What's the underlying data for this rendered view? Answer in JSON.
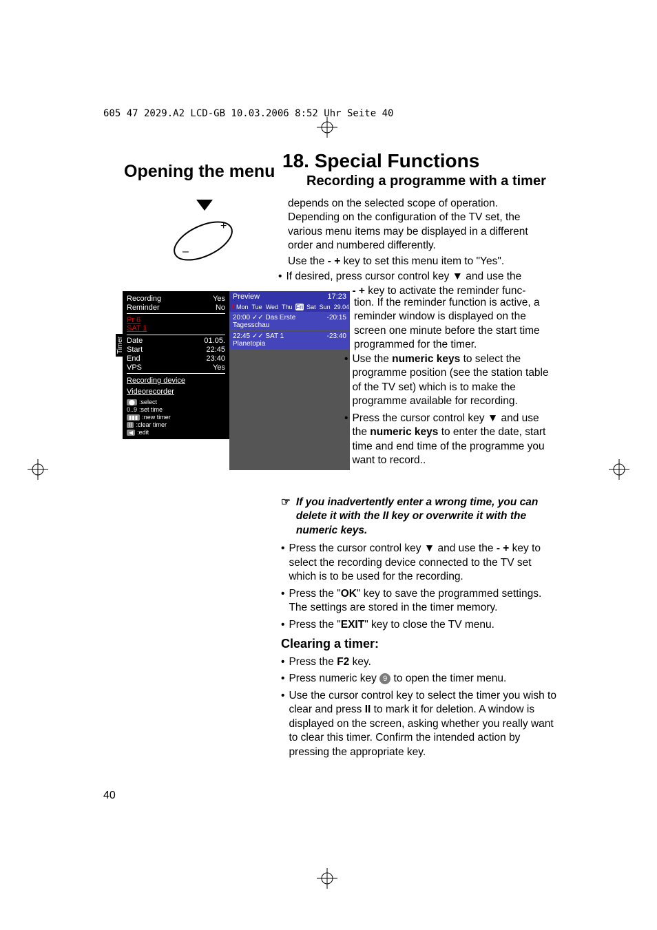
{
  "header_line": "605 47 2029.A2 LCD-GB  10.03.2006  8:52 Uhr  Seite 40",
  "opening_title": "Opening the menu",
  "section_number": "18.",
  "section_title": "Special Functions",
  "subtitle": "Recording a programme with a timer",
  "timer": {
    "vert_label": "Timer",
    "recording_label": "Recording",
    "recording_val": "Yes",
    "reminder_label": "Reminder",
    "reminder_val": "No",
    "pr": "Pr   6",
    "sat": "SAT 1",
    "date_label": "Date",
    "date_val": "01.05.",
    "start_label": "Start",
    "start_val": "22:45",
    "end_label": "End",
    "end_val": "23:40",
    "vps_label": "VPS",
    "vps_val": "Yes",
    "device_label": "Recording device",
    "device_val": "Videorecorder",
    "legend": [
      {
        "key": "⬤",
        "text": ":select"
      },
      {
        "key": "0..9",
        "text": ":set time"
      },
      {
        "key": "▮▮▮",
        "text": ":new timer"
      },
      {
        "key": "II",
        "text": ":clear timer"
      },
      {
        "key": "◀",
        "text": ":edit"
      }
    ]
  },
  "preview": {
    "title": "Preview",
    "time": "17:23",
    "days": [
      "Mon",
      "Tue",
      "Wed",
      "Thu",
      "Fri",
      "Sat",
      "Sun"
    ],
    "date": "29.04.",
    "items": [
      {
        "start": "20:00",
        "marks": "✓✓",
        "channel": "Das Erste",
        "name": "Tagesschau",
        "end": "-20:15"
      },
      {
        "start": "22:45",
        "marks": "✓✓",
        "channel": "SAT 1",
        "name": "Planetopia",
        "end": "-23:40"
      }
    ]
  },
  "body": {
    "p1": "depends on the selected scope of operation. Depending on the configuration of the TV set, the various menu items may be displayed in a different order and numbered differently.",
    "p2a": "Use the ",
    "p2b": " key to set this menu item to \"Yes\".",
    "b1a": "If desired, press cursor control key ▼ and use the",
    "b1b": " key to activate the reminder func-",
    "i1": "tion. If the reminder function is active, a reminder window is displayed on the screen one minute before the start time programmed for the timer.",
    "i2a": "Use the ",
    "i2b": "numeric keys",
    "i2c": " to select the programme position (see the station table of the TV set) which is to make the programme available for recording.",
    "i3a": "Press the cursor control key ▼ and use the ",
    "i3b": "numeric keys",
    "i3c": " to enter the date, start time and end time of the programme you want to record..",
    "note": "If you inadvertently enter a wrong time, you can delete it with the II key or overwrite it with the numeric keys.",
    "b4a": "Press the cursor control key ▼ and use the ",
    "b4b": " key to select the recording device connected to the TV set which is to be used for the recording.",
    "b5a": "Press the \"",
    "b5b": "OK",
    "b5c": "\" key to save the programmed settings. The settings are stored in the timer memory.",
    "b6a": "Press the \"",
    "b6b": "EXIT",
    "b6c": "\" key to close the TV menu.",
    "clearing": "Clearing a timer:",
    "c1a": "Press the ",
    "c1b": "F2",
    "c1c": " key.",
    "c2a": "Press numeric key ",
    "c2b": "9",
    "c2c": " to open the timer menu.",
    "c3a": "Use the cursor control key to select the timer you wish to clear and press ",
    "c3b": "II",
    "c3c": " to mark it for deletion. A window is displayed on the screen, asking whether you really want to clear this timer. Confirm the intended action by pressing the appropriate key."
  },
  "page_num": "40",
  "minus_plus": "- +"
}
